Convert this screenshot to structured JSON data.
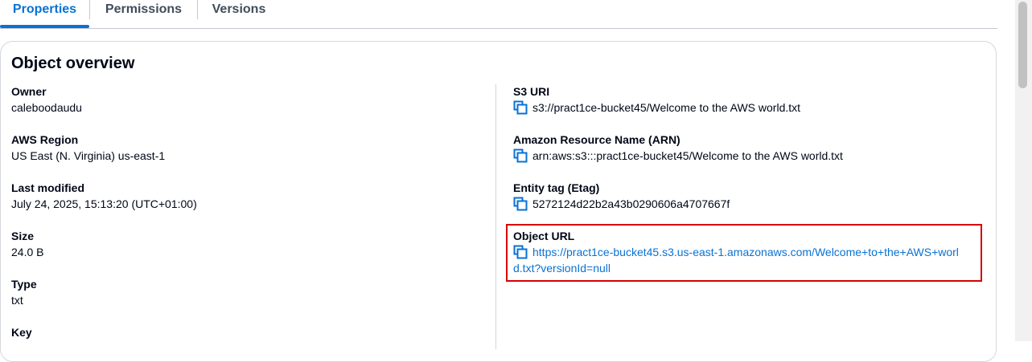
{
  "tabs": [
    {
      "label": "Properties",
      "active": true
    },
    {
      "label": "Permissions",
      "active": false
    },
    {
      "label": "Versions",
      "active": false
    }
  ],
  "overview": {
    "title": "Object overview",
    "left": [
      {
        "label": "Owner",
        "value": "caleboodaudu"
      },
      {
        "label": "AWS Region",
        "value": "US East (N. Virginia) us-east-1"
      },
      {
        "label": "Last modified",
        "value": "July 24, 2025, 15:13:20 (UTC+01:00)"
      },
      {
        "label": "Size",
        "value": "24.0 B"
      },
      {
        "label": "Type",
        "value": "txt"
      },
      {
        "label": "Key",
        "value": ""
      }
    ],
    "right": [
      {
        "label": "S3 URI",
        "value": "s3://pract1ce-bucket45/Welcome to the AWS world.txt"
      },
      {
        "label": "Amazon Resource Name (ARN)",
        "value": "arn:aws:s3:::pract1ce-bucket45/Welcome to the AWS world.txt"
      },
      {
        "label": "Entity tag (Etag)",
        "value": "5272124d22b2a43b0290606a4707667f"
      },
      {
        "label": "Object URL",
        "value_line1": "https://pract1ce-bucket45.s3.us-east-1.amazonaws.com/Welcome+to+the+AWS+worl",
        "value_line2": "d.txt?versionId=null"
      }
    ]
  },
  "icons": {
    "copy": "copy-icon"
  },
  "colors": {
    "accent": "#0972d3",
    "highlight": "#d60000",
    "text": "#000716"
  }
}
